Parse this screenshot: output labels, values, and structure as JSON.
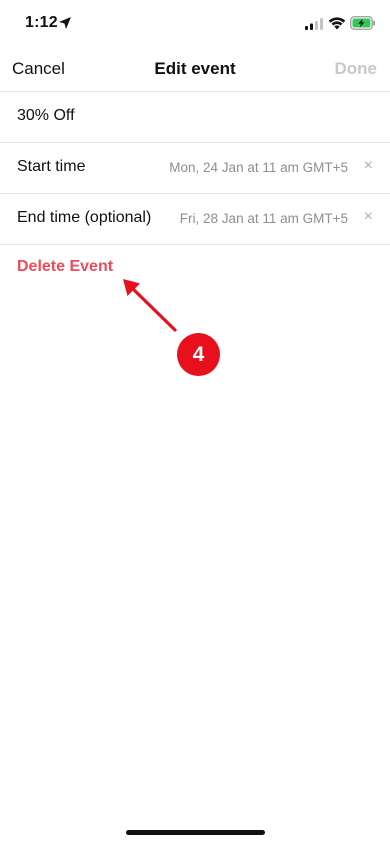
{
  "status_bar": {
    "time": "1:12"
  },
  "nav": {
    "cancel_label": "Cancel",
    "title": "Edit event",
    "done_label": "Done"
  },
  "rows": [
    {
      "label": "30% Off"
    },
    {
      "label": "Start time",
      "value": "Mon, 24 Jan at 11 am GMT+5",
      "clear_icon": "×"
    },
    {
      "label": "End time (optional)",
      "value": "Fri, 28 Jan at 11 am GMT+5",
      "clear_icon": "×"
    }
  ],
  "delete_label": "Delete Event",
  "annotation": {
    "step_number": "4",
    "color": "#e8101c"
  },
  "colors": {
    "destructive": "#ef4b5a",
    "disabled": "#c7c7cc",
    "secondary_text": "#8e8e93"
  }
}
